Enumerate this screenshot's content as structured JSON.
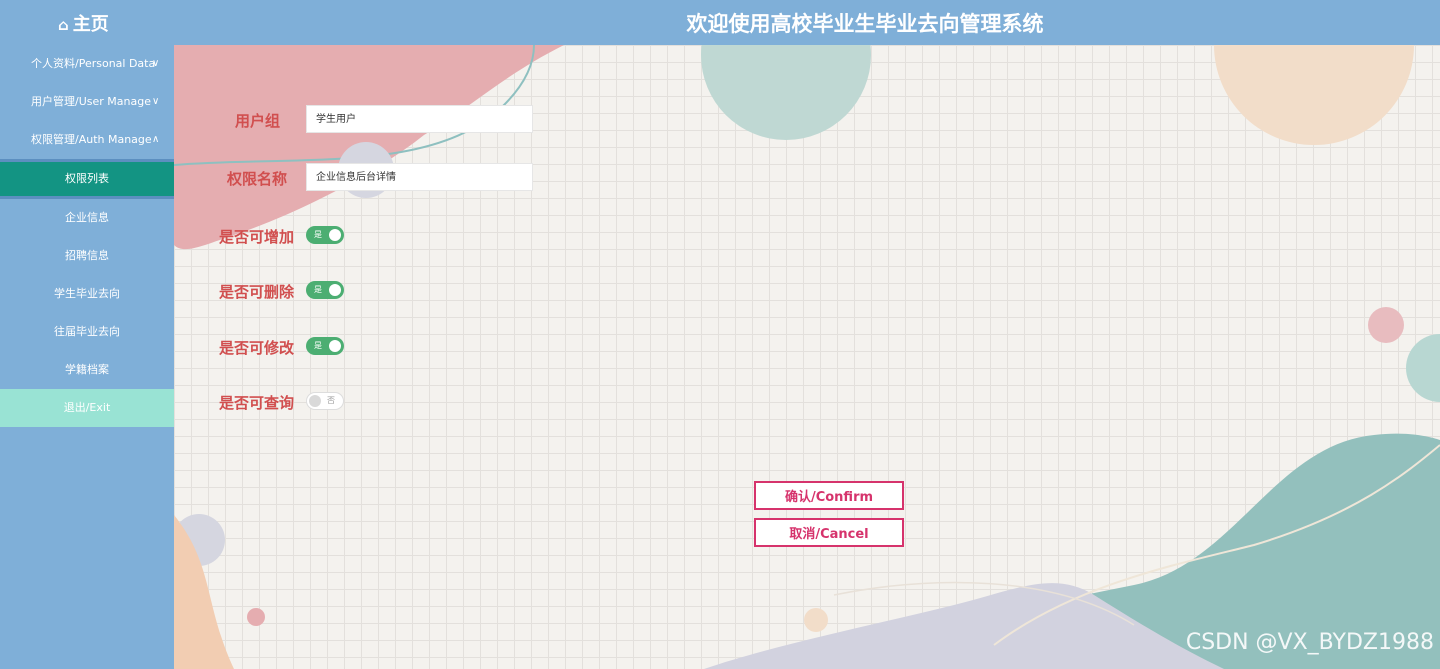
{
  "header": {
    "home_icon": "home-icon",
    "home_label": "主页",
    "title": "欢迎使用高校毕业生毕业去向管理系统"
  },
  "sidebar": {
    "menus": [
      {
        "label": "个人资料/Personal Data",
        "chevron": "∨"
      },
      {
        "label": "用户管理/User Manage",
        "chevron": "∨"
      },
      {
        "label": "权限管理/Auth Manage",
        "chevron": "∧"
      }
    ],
    "sub_items": [
      {
        "label": "权限列表"
      },
      {
        "label": "企业信息"
      },
      {
        "label": "招聘信息"
      },
      {
        "label": "学生毕业去向"
      },
      {
        "label": "往届毕业去向"
      },
      {
        "label": "学籍档案"
      },
      {
        "label": "退出/Exit"
      }
    ]
  },
  "form": {
    "user_group_label": "用户组",
    "user_group_value": "学生用户",
    "perm_name_label": "权限名称",
    "perm_name_value": "企业信息后台详情",
    "can_add_label": "是否可增加",
    "can_add_text": "是",
    "can_delete_label": "是否可删除",
    "can_delete_text": "是",
    "can_edit_label": "是否可修改",
    "can_edit_text": "是",
    "can_query_label": "是否可查询",
    "can_query_text": "否"
  },
  "buttons": {
    "confirm": "确认/Confirm",
    "cancel": "取消/Cancel"
  },
  "watermark": "CSDN @VX_BYDZ1988",
  "colors": {
    "header_bg": "#7fafd8",
    "active_item": "#139483",
    "exit_item": "#99e3d4",
    "label_red": "#d14f4f",
    "switch_on": "#4cae72",
    "button_border": "#d6336c"
  }
}
